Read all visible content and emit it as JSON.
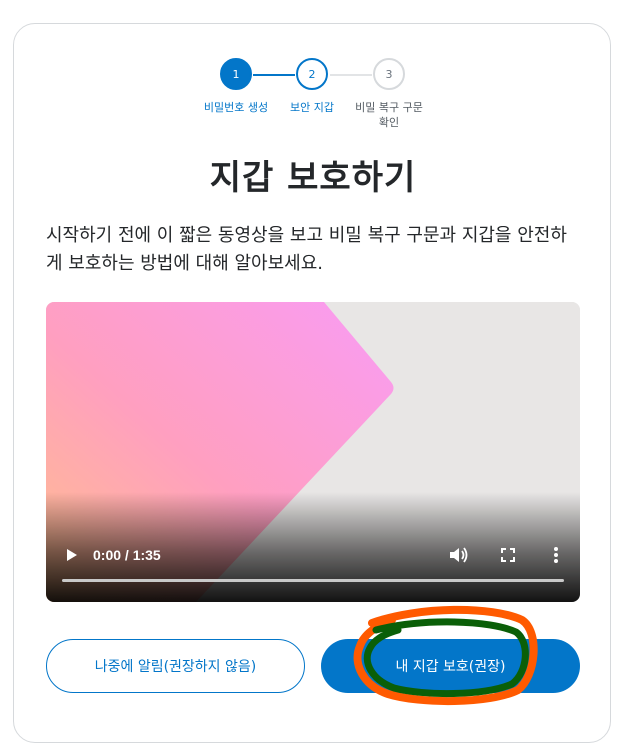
{
  "stepper": {
    "steps": [
      {
        "number": "1",
        "label": "비밀번호 생성"
      },
      {
        "number": "2",
        "label": "보안 지갑"
      },
      {
        "number": "3",
        "label": "비밀 복구 구문 확인"
      }
    ]
  },
  "title": "지갑 보호하기",
  "description": "시작하기 전에 이 짧은 동영상을 보고 비밀 복구 구문과 지갑을 안전하게 보호하는 방법에 대해 알아보세요.",
  "video": {
    "time": "0:00 / 1:35",
    "progress": 0,
    "icons": [
      "play-icon",
      "volume-icon",
      "fullscreen-icon",
      "more-vert-icon"
    ]
  },
  "buttons": {
    "remind_later": "나중에 알림(권장하지 않음)",
    "secure_wallet": "내 지갑 보호(권장)"
  },
  "colors": {
    "primary": "#0376c9",
    "annotation_orange": "#ff5a00",
    "annotation_green": "#0a5f08"
  }
}
